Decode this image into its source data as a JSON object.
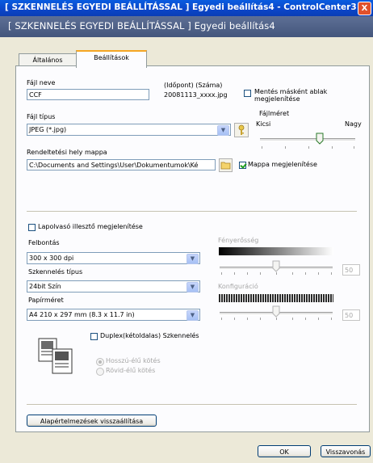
{
  "window": {
    "title": "[ SZKENNELÉS EGYEDI BEÁLLÍTÁSSAL ] Egyedi beállítás4 - ControlCenter3 ...",
    "close": "X"
  },
  "header": {
    "title": "[ SZKENNELÉS EGYEDI BEÁLLÍTÁSSAL ]  Egyedi beállítás4"
  },
  "tabs": [
    {
      "label": "Általános"
    },
    {
      "label": "Beállítások"
    }
  ],
  "file": {
    "name_label": "Fájl neve",
    "name_value": "CCF",
    "stamp_label": "(Időpont) (Száma)",
    "stamp_value": "20081113_xxxx.jpg",
    "save_as_label": "Mentés másként ablak megjelenítése",
    "type_label": "Fájl típus",
    "type_value": "JPEG (*.jpg)",
    "size_label": "Fájlméret",
    "size_min": "Kicsi",
    "size_max": "Nagy",
    "size_level": 0.6,
    "dest_label": "Rendeltetési hely mappa",
    "dest_value": "C:\\Documents and Settings\\User\\Dokumentumok\\Ké",
    "show_folder_label": "Mappa megjelenítése"
  },
  "scan": {
    "show_scanner_ui_label": "Lapolvasó illesztő megjelenítése",
    "resolution_label": "Felbontás",
    "resolution_value": "300 x 300 dpi",
    "scan_type_label": "Szkennelés típus",
    "scan_type_value": "24bit Szín",
    "paper_label": "Papírméret",
    "paper_value": "A4 210 x 297 mm (8.3 x 11.7 in)",
    "brightness_label": "Fényerősség",
    "brightness_value": "50",
    "brightness_level": 0.5,
    "contrast_label": "Konfiguráció",
    "contrast_value": "50",
    "contrast_level": 0.5,
    "duplex_label": "Duplex(kétoldalas) Szkennelés",
    "long_edge_label": "Hosszú-élű kötés",
    "short_edge_label": "Rövid-élű kötés"
  },
  "buttons": {
    "restore": "Alapértelmezések visszaállítása",
    "ok": "OK",
    "cancel": "Visszavonás"
  }
}
